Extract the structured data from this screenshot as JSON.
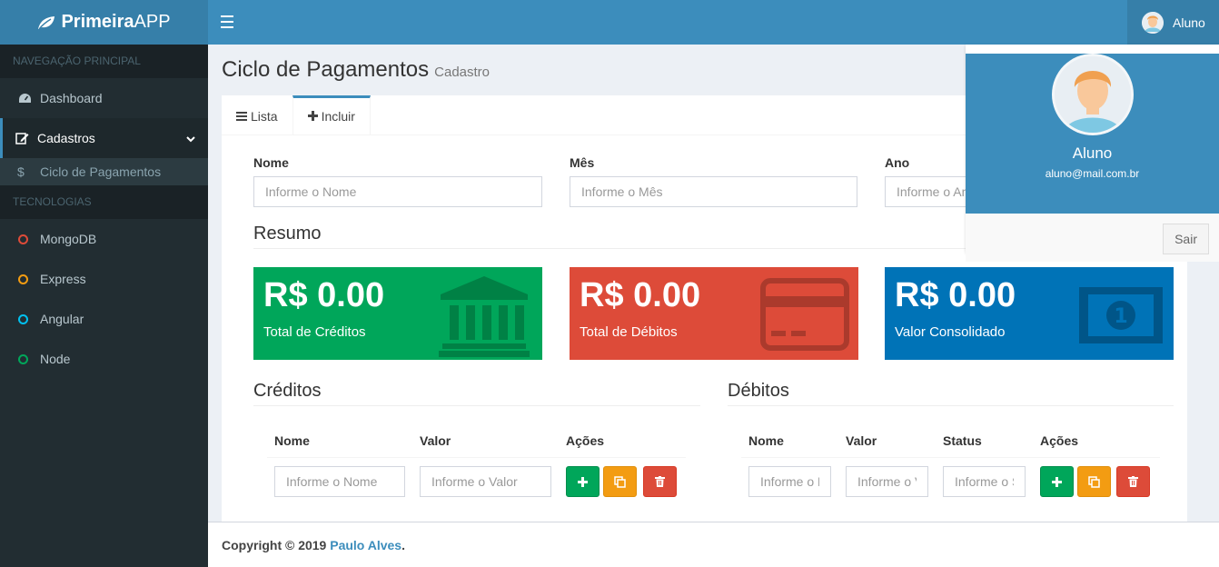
{
  "app": {
    "logo_bold": "Primeira",
    "logo_rest": "APP"
  },
  "header": {
    "user_name": "Aluno"
  },
  "sidebar": {
    "section_main": "NAVEGAÇÃO PRINCIPAL",
    "dashboard": "Dashboard",
    "cadastros": "Cadastros",
    "ciclo": "Ciclo de Pagamentos",
    "section_tech": "TECNOLOGIAS",
    "tech": [
      {
        "label": "MongoDB",
        "color": "#dd4b39"
      },
      {
        "label": "Express",
        "color": "#f39c12"
      },
      {
        "label": "Angular",
        "color": "#00c0ef"
      },
      {
        "label": "Node",
        "color": "#00a65a"
      }
    ]
  },
  "page": {
    "title": "Ciclo de Pagamentos",
    "subtitle": "Cadastro"
  },
  "tabs": {
    "lista": "Lista",
    "incluir": "Incluir"
  },
  "form": {
    "nome_label": "Nome",
    "nome_placeholder": "Informe o Nome",
    "mes_label": "Mês",
    "mes_placeholder": "Informe o Mês",
    "ano_label": "Ano",
    "ano_placeholder": "Informe o Ano"
  },
  "resumo": {
    "title": "Resumo",
    "creditos": {
      "amount": "R$ 0.00",
      "label": "Total de Créditos",
      "color": "#00a65a"
    },
    "debitos": {
      "amount": "R$ 0.00",
      "label": "Total de Débitos",
      "color": "#dd4b39"
    },
    "consolidado": {
      "amount": "R$ 0.00",
      "label": "Valor Consolidado",
      "color": "#0073b7"
    }
  },
  "creditos": {
    "title": "Créditos",
    "col_nome": "Nome",
    "col_valor": "Valor",
    "col_acoes": "Ações",
    "nome_placeholder": "Informe o Nome",
    "valor_placeholder": "Informe o Valor"
  },
  "debitos": {
    "title": "Débitos",
    "col_nome": "Nome",
    "col_valor": "Valor",
    "col_status": "Status",
    "col_acoes": "Ações",
    "nome_placeholder": "Informe o Nome",
    "valor_placeholder": "Informe o Valor",
    "status_placeholder": "Informe o Status"
  },
  "footer": {
    "prefix": "Copyright © 2019 ",
    "author": "Paulo Alves",
    "suffix": "."
  },
  "user_dropdown": {
    "name": "Aluno",
    "email": "aluno@mail.com.br",
    "signout": "Sair"
  }
}
